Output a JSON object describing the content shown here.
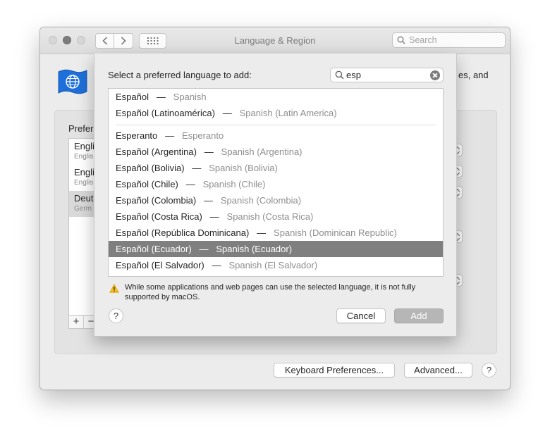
{
  "window": {
    "title": "Language & Region",
    "search_placeholder": "Search",
    "description_fragment": "es, and"
  },
  "preferred": {
    "label": "Prefer",
    "languages": [
      {
        "name": "Engli",
        "sub": "Englis"
      },
      {
        "name": "Engli",
        "sub": "Englis"
      },
      {
        "name": "Deut",
        "sub": "Germ"
      }
    ],
    "add_label": "+",
    "remove_label": "−"
  },
  "footer": {
    "keyboard_prefs_label": "Keyboard Preferences...",
    "advanced_label": "Advanced...",
    "help_label": "?"
  },
  "sheet": {
    "prompt": "Select a preferred language to add:",
    "search_value": "esp",
    "languages": [
      {
        "native": "Español",
        "english": "Spanish"
      },
      {
        "native": "Español (Latinoamérica)",
        "english": "Spanish (Latin America)"
      },
      {
        "native": "Esperanto",
        "english": "Esperanto"
      },
      {
        "native": "Español (Argentina)",
        "english": "Spanish (Argentina)"
      },
      {
        "native": "Español (Bolivia)",
        "english": "Spanish (Bolivia)"
      },
      {
        "native": "Español (Chile)",
        "english": "Spanish (Chile)"
      },
      {
        "native": "Español (Colombia)",
        "english": "Spanish (Colombia)"
      },
      {
        "native": "Español (Costa Rica)",
        "english": "Spanish (Costa Rica)"
      },
      {
        "native": "Español (República Dominicana)",
        "english": "Spanish (Dominican Republic)"
      },
      {
        "native": "Español (Ecuador)",
        "english": "Spanish (Ecuador)"
      },
      {
        "native": "Español (El Salvador)",
        "english": "Spanish (El Salvador)"
      }
    ],
    "separator": "—",
    "selected_index": 9,
    "warning": "While some applications and web pages can use the selected language, it is not fully supported by macOS.",
    "cancel_label": "Cancel",
    "add_label": "Add",
    "help_label": "?"
  },
  "icons": {
    "window_controls": [
      "close-button",
      "minimize-button",
      "zoom-button"
    ],
    "nav": [
      "chevron-left-icon",
      "chevron-right-icon",
      "grid-icon"
    ],
    "search": "magnifier-icon",
    "clear": "clear-circle-icon",
    "warning": "warning-triangle-icon",
    "pane": "flag-globe-icon"
  },
  "colors": {
    "selection": "#7f7f7f",
    "warning_icon": "#f5bd1f",
    "flag_blue": "#1e6fd9"
  }
}
